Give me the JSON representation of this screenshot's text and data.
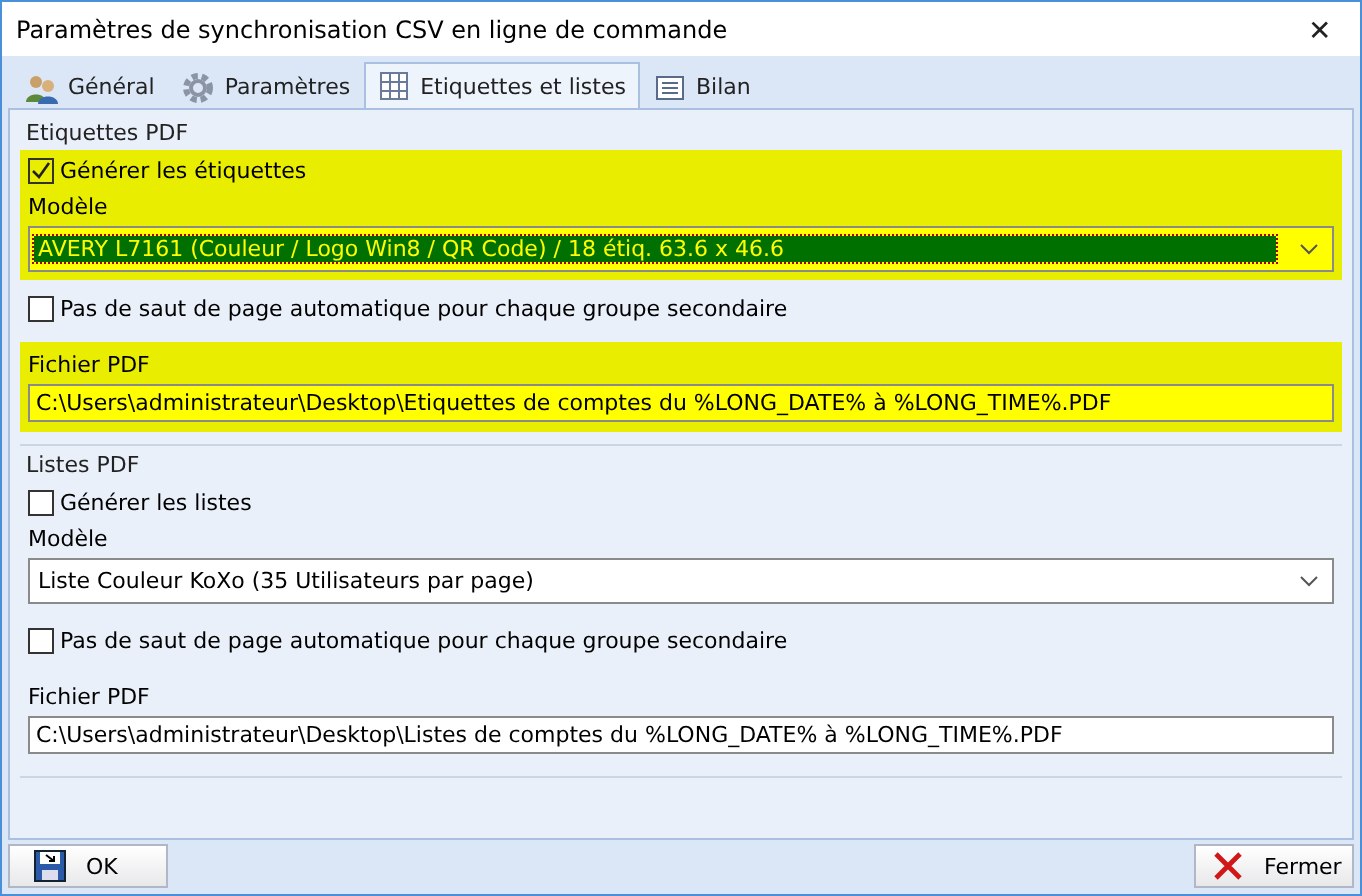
{
  "window": {
    "title": "Paramètres de synchronisation CSV en ligne de commande",
    "close": "✕"
  },
  "tabs": [
    {
      "label": "Général",
      "kind": "users",
      "selected": false
    },
    {
      "label": "Paramètres",
      "kind": "gear",
      "selected": false
    },
    {
      "label": "Etiquettes et listes",
      "kind": "grid",
      "selected": true
    },
    {
      "label": "Bilan",
      "kind": "list",
      "selected": false
    }
  ],
  "sections": [
    {
      "title": "Etiquettes PDF",
      "highlighted": true,
      "generate": {
        "label": "Générer les étiquettes",
        "checked": true
      },
      "model_label": "Modèle",
      "model_value": "AVERY L7161 (Couleur / Logo Win8 / QR Code) / 18 étiq. 63.6 x 46.6",
      "model_focused": true,
      "no_break": {
        "label": "Pas de saut de page automatique pour chaque groupe secondaire",
        "checked": false
      },
      "file_label": "Fichier PDF",
      "file_value": "C:\\Users\\administrateur\\Desktop\\Etiquettes de comptes du %LONG_DATE% à %LONG_TIME%.PDF"
    },
    {
      "title": "Listes PDF",
      "highlighted": false,
      "generate": {
        "label": "Générer les listes",
        "checked": false
      },
      "model_label": "Modèle",
      "model_value": "Liste Couleur KoXo (35 Utilisateurs par page)",
      "model_focused": false,
      "no_break": {
        "label": "Pas de saut de page automatique pour chaque groupe secondaire",
        "checked": false
      },
      "file_label": "Fichier PDF",
      "file_value": "C:\\Users\\administrateur\\Desktop\\Listes de comptes du %LONG_DATE% à %LONG_TIME%.PDF"
    }
  ],
  "buttons": [
    {
      "label": "OK",
      "kind": "save"
    },
    {
      "label": "Fermer",
      "kind": "close"
    }
  ]
}
